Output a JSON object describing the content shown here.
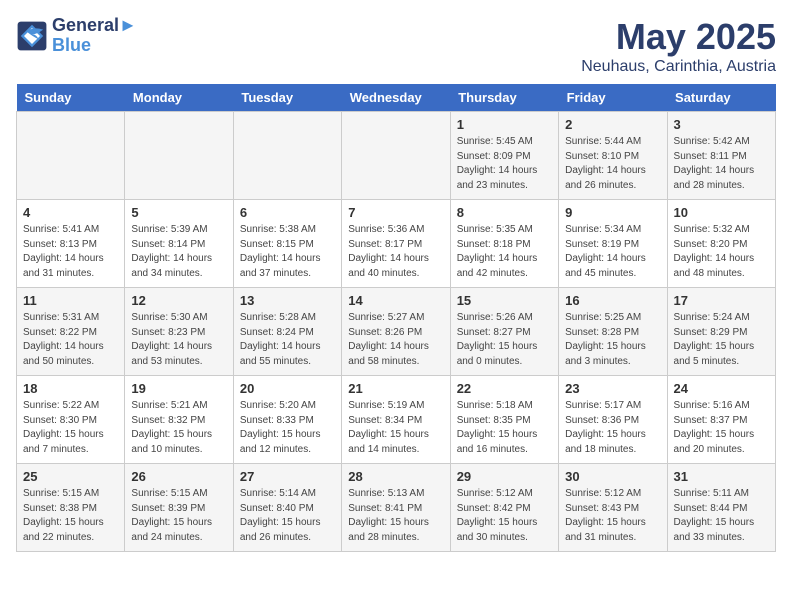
{
  "header": {
    "logo_line1": "General",
    "logo_line2": "Blue",
    "month": "May 2025",
    "location": "Neuhaus, Carinthia, Austria"
  },
  "weekdays": [
    "Sunday",
    "Monday",
    "Tuesday",
    "Wednesday",
    "Thursday",
    "Friday",
    "Saturday"
  ],
  "weeks": [
    [
      {
        "day": "",
        "info": ""
      },
      {
        "day": "",
        "info": ""
      },
      {
        "day": "",
        "info": ""
      },
      {
        "day": "",
        "info": ""
      },
      {
        "day": "1",
        "info": "Sunrise: 5:45 AM\nSunset: 8:09 PM\nDaylight: 14 hours\nand 23 minutes."
      },
      {
        "day": "2",
        "info": "Sunrise: 5:44 AM\nSunset: 8:10 PM\nDaylight: 14 hours\nand 26 minutes."
      },
      {
        "day": "3",
        "info": "Sunrise: 5:42 AM\nSunset: 8:11 PM\nDaylight: 14 hours\nand 28 minutes."
      }
    ],
    [
      {
        "day": "4",
        "info": "Sunrise: 5:41 AM\nSunset: 8:13 PM\nDaylight: 14 hours\nand 31 minutes."
      },
      {
        "day": "5",
        "info": "Sunrise: 5:39 AM\nSunset: 8:14 PM\nDaylight: 14 hours\nand 34 minutes."
      },
      {
        "day": "6",
        "info": "Sunrise: 5:38 AM\nSunset: 8:15 PM\nDaylight: 14 hours\nand 37 minutes."
      },
      {
        "day": "7",
        "info": "Sunrise: 5:36 AM\nSunset: 8:17 PM\nDaylight: 14 hours\nand 40 minutes."
      },
      {
        "day": "8",
        "info": "Sunrise: 5:35 AM\nSunset: 8:18 PM\nDaylight: 14 hours\nand 42 minutes."
      },
      {
        "day": "9",
        "info": "Sunrise: 5:34 AM\nSunset: 8:19 PM\nDaylight: 14 hours\nand 45 minutes."
      },
      {
        "day": "10",
        "info": "Sunrise: 5:32 AM\nSunset: 8:20 PM\nDaylight: 14 hours\nand 48 minutes."
      }
    ],
    [
      {
        "day": "11",
        "info": "Sunrise: 5:31 AM\nSunset: 8:22 PM\nDaylight: 14 hours\nand 50 minutes."
      },
      {
        "day": "12",
        "info": "Sunrise: 5:30 AM\nSunset: 8:23 PM\nDaylight: 14 hours\nand 53 minutes."
      },
      {
        "day": "13",
        "info": "Sunrise: 5:28 AM\nSunset: 8:24 PM\nDaylight: 14 hours\nand 55 minutes."
      },
      {
        "day": "14",
        "info": "Sunrise: 5:27 AM\nSunset: 8:26 PM\nDaylight: 14 hours\nand 58 minutes."
      },
      {
        "day": "15",
        "info": "Sunrise: 5:26 AM\nSunset: 8:27 PM\nDaylight: 15 hours\nand 0 minutes."
      },
      {
        "day": "16",
        "info": "Sunrise: 5:25 AM\nSunset: 8:28 PM\nDaylight: 15 hours\nand 3 minutes."
      },
      {
        "day": "17",
        "info": "Sunrise: 5:24 AM\nSunset: 8:29 PM\nDaylight: 15 hours\nand 5 minutes."
      }
    ],
    [
      {
        "day": "18",
        "info": "Sunrise: 5:22 AM\nSunset: 8:30 PM\nDaylight: 15 hours\nand 7 minutes."
      },
      {
        "day": "19",
        "info": "Sunrise: 5:21 AM\nSunset: 8:32 PM\nDaylight: 15 hours\nand 10 minutes."
      },
      {
        "day": "20",
        "info": "Sunrise: 5:20 AM\nSunset: 8:33 PM\nDaylight: 15 hours\nand 12 minutes."
      },
      {
        "day": "21",
        "info": "Sunrise: 5:19 AM\nSunset: 8:34 PM\nDaylight: 15 hours\nand 14 minutes."
      },
      {
        "day": "22",
        "info": "Sunrise: 5:18 AM\nSunset: 8:35 PM\nDaylight: 15 hours\nand 16 minutes."
      },
      {
        "day": "23",
        "info": "Sunrise: 5:17 AM\nSunset: 8:36 PM\nDaylight: 15 hours\nand 18 minutes."
      },
      {
        "day": "24",
        "info": "Sunrise: 5:16 AM\nSunset: 8:37 PM\nDaylight: 15 hours\nand 20 minutes."
      }
    ],
    [
      {
        "day": "25",
        "info": "Sunrise: 5:15 AM\nSunset: 8:38 PM\nDaylight: 15 hours\nand 22 minutes."
      },
      {
        "day": "26",
        "info": "Sunrise: 5:15 AM\nSunset: 8:39 PM\nDaylight: 15 hours\nand 24 minutes."
      },
      {
        "day": "27",
        "info": "Sunrise: 5:14 AM\nSunset: 8:40 PM\nDaylight: 15 hours\nand 26 minutes."
      },
      {
        "day": "28",
        "info": "Sunrise: 5:13 AM\nSunset: 8:41 PM\nDaylight: 15 hours\nand 28 minutes."
      },
      {
        "day": "29",
        "info": "Sunrise: 5:12 AM\nSunset: 8:42 PM\nDaylight: 15 hours\nand 30 minutes."
      },
      {
        "day": "30",
        "info": "Sunrise: 5:12 AM\nSunset: 8:43 PM\nDaylight: 15 hours\nand 31 minutes."
      },
      {
        "day": "31",
        "info": "Sunrise: 5:11 AM\nSunset: 8:44 PM\nDaylight: 15 hours\nand 33 minutes."
      }
    ]
  ]
}
